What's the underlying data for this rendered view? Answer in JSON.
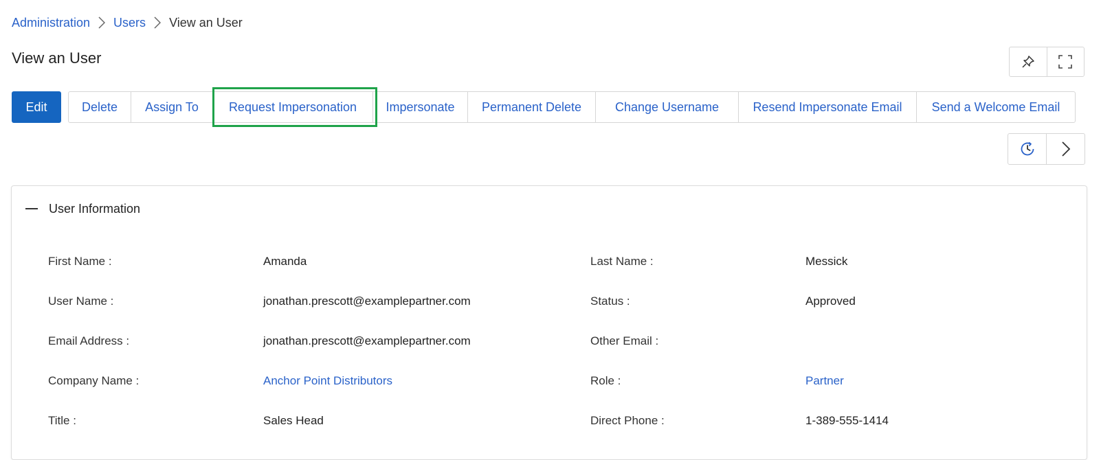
{
  "breadcrumb": {
    "items": [
      "Administration",
      "Users"
    ],
    "current": "View an User"
  },
  "page": {
    "title": "View an User"
  },
  "toolbar": {
    "edit_label": "Edit",
    "actions": [
      "Delete",
      "Assign To",
      "Request Impersonation",
      "Impersonate",
      "Permanent Delete",
      "Change Username",
      "Resend Impersonate Email",
      "Send a Welcome Email"
    ],
    "highlighted_action": "Request Impersonation"
  },
  "icons": {
    "pin": "pin-icon",
    "expand": "expand-icon",
    "history": "history-icon",
    "next": "chevron-right-icon",
    "collapse": "minus-icon"
  },
  "colors": {
    "primary": "#1565c0",
    "link": "#2a62c9",
    "highlight": "#1fa34a"
  },
  "panel": {
    "title": "User Information",
    "fields": {
      "first_name": {
        "label": "First Name :",
        "value": "Amanda"
      },
      "last_name": {
        "label": "Last Name :",
        "value": "Messick"
      },
      "user_name": {
        "label": "User Name :",
        "value": "jonathan.prescott@examplepartner.com"
      },
      "status": {
        "label": "Status :",
        "value": "Approved"
      },
      "email": {
        "label": "Email Address :",
        "value": "jonathan.prescott@examplepartner.com"
      },
      "other_email": {
        "label": "Other Email :",
        "value": ""
      },
      "company": {
        "label": "Company Name :",
        "value": "Anchor Point Distributors"
      },
      "role": {
        "label": "Role :",
        "value": "Partner"
      },
      "title": {
        "label": "Title :",
        "value": "Sales Head"
      },
      "direct_phone": {
        "label": "Direct Phone :",
        "value": "1-389-555-1414"
      }
    }
  }
}
